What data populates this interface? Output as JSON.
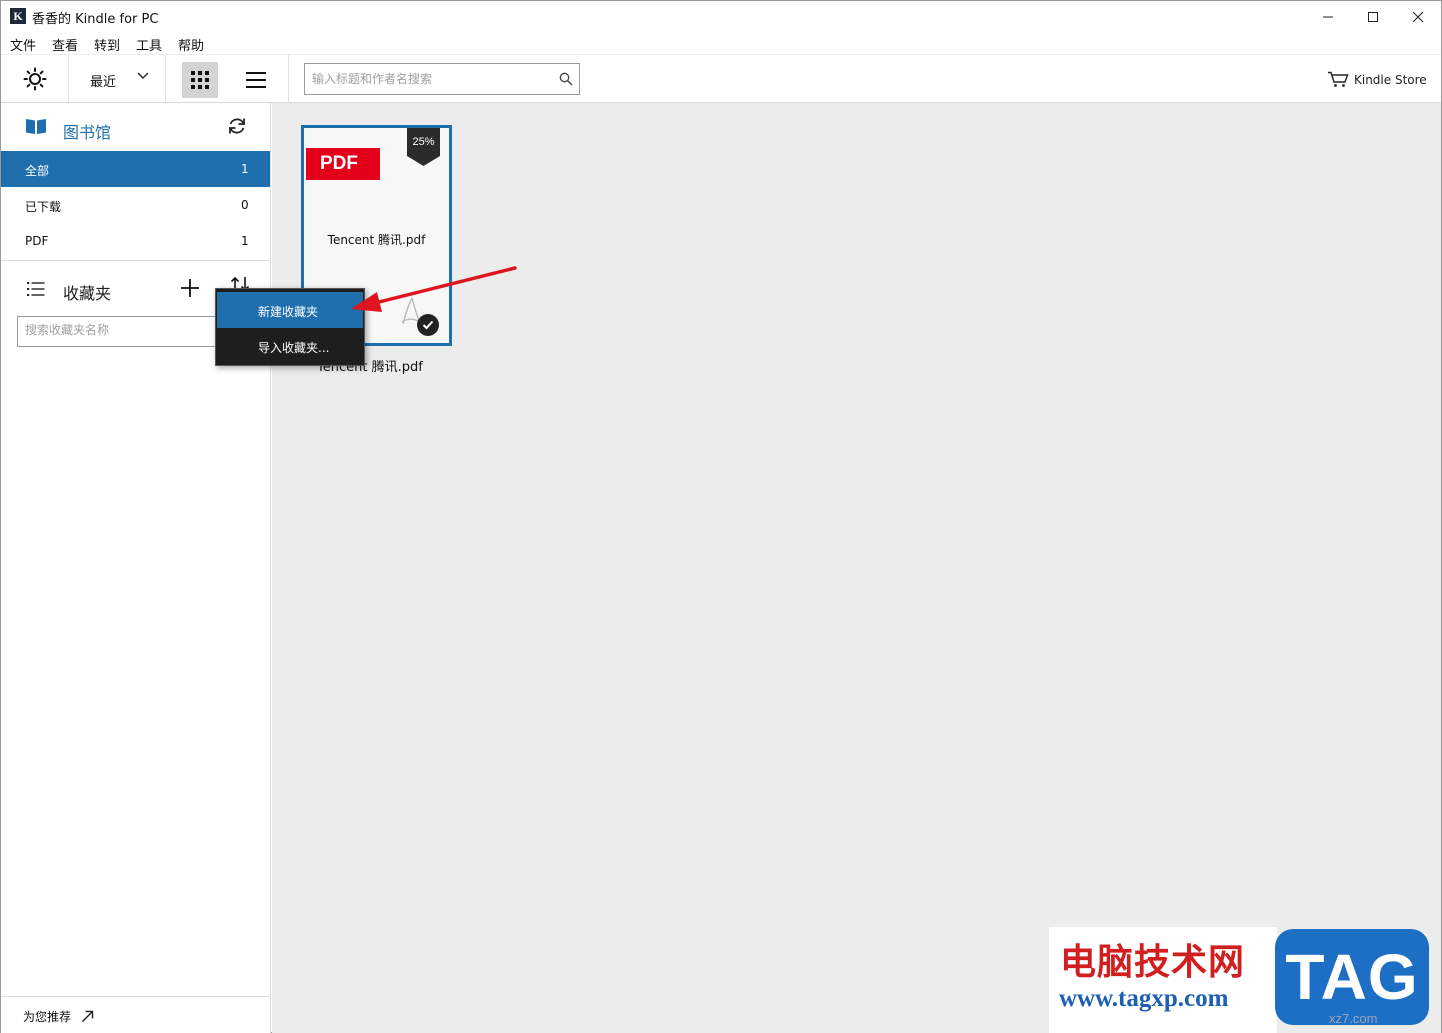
{
  "window": {
    "title": "香香的 Kindle for PC",
    "app_icon_letter": "K"
  },
  "menu": [
    "文件",
    "查看",
    "转到",
    "工具",
    "帮助"
  ],
  "toolbar": {
    "sort_label": "最近",
    "search_placeholder": "输入标题和作者名搜索",
    "store_label": "Kindle Store"
  },
  "library": {
    "title": "图书馆",
    "items": [
      {
        "label": "全部",
        "count": "1",
        "active": true
      },
      {
        "label": "已下载",
        "count": "0",
        "active": false
      },
      {
        "label": "PDF",
        "count": "1",
        "active": false
      }
    ]
  },
  "collections": {
    "title": "收藏夹",
    "search_placeholder": "搜索收藏夹名称"
  },
  "context_menu": {
    "items": [
      "新建收藏夹",
      "导入收藏夹..."
    ]
  },
  "recommend_label": "为您推荐",
  "book": {
    "badge": "PDF",
    "progress": "25%",
    "cover_title": "Tencent 腾讯.pdf",
    "caption": "Tencent 腾讯.pdf"
  },
  "watermark": {
    "cn": "电脑技术网",
    "url": "www.tagxp.com",
    "tag": "TAG",
    "small": "xz7.com"
  },
  "colors": {
    "accent": "#1f6fad",
    "pdf_red": "#e3001b",
    "arrow_red": "#e0141e"
  }
}
